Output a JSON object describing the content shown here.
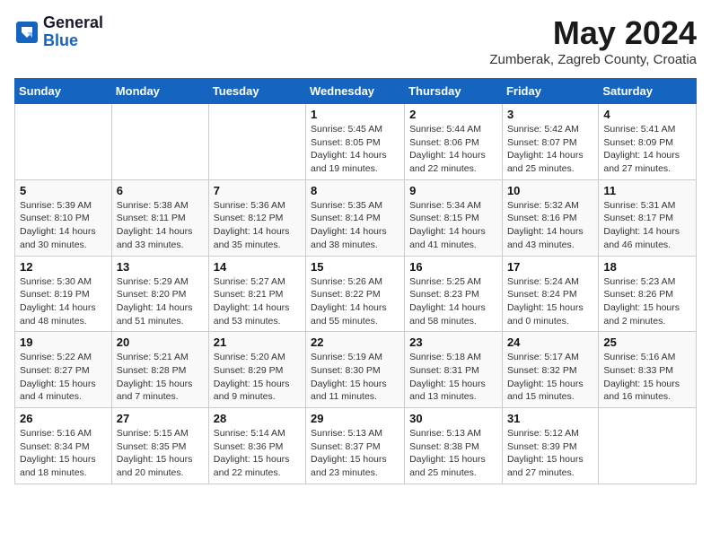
{
  "logo": {
    "general": "General",
    "blue": "Blue"
  },
  "header": {
    "month": "May 2024",
    "location": "Zumberak, Zagreb County, Croatia"
  },
  "weekdays": [
    "Sunday",
    "Monday",
    "Tuesday",
    "Wednesday",
    "Thursday",
    "Friday",
    "Saturday"
  ],
  "weeks": [
    [
      {
        "day": "",
        "info": ""
      },
      {
        "day": "",
        "info": ""
      },
      {
        "day": "",
        "info": ""
      },
      {
        "day": "1",
        "info": "Sunrise: 5:45 AM\nSunset: 8:05 PM\nDaylight: 14 hours\nand 19 minutes."
      },
      {
        "day": "2",
        "info": "Sunrise: 5:44 AM\nSunset: 8:06 PM\nDaylight: 14 hours\nand 22 minutes."
      },
      {
        "day": "3",
        "info": "Sunrise: 5:42 AM\nSunset: 8:07 PM\nDaylight: 14 hours\nand 25 minutes."
      },
      {
        "day": "4",
        "info": "Sunrise: 5:41 AM\nSunset: 8:09 PM\nDaylight: 14 hours\nand 27 minutes."
      }
    ],
    [
      {
        "day": "5",
        "info": "Sunrise: 5:39 AM\nSunset: 8:10 PM\nDaylight: 14 hours\nand 30 minutes."
      },
      {
        "day": "6",
        "info": "Sunrise: 5:38 AM\nSunset: 8:11 PM\nDaylight: 14 hours\nand 33 minutes."
      },
      {
        "day": "7",
        "info": "Sunrise: 5:36 AM\nSunset: 8:12 PM\nDaylight: 14 hours\nand 35 minutes."
      },
      {
        "day": "8",
        "info": "Sunrise: 5:35 AM\nSunset: 8:14 PM\nDaylight: 14 hours\nand 38 minutes."
      },
      {
        "day": "9",
        "info": "Sunrise: 5:34 AM\nSunset: 8:15 PM\nDaylight: 14 hours\nand 41 minutes."
      },
      {
        "day": "10",
        "info": "Sunrise: 5:32 AM\nSunset: 8:16 PM\nDaylight: 14 hours\nand 43 minutes."
      },
      {
        "day": "11",
        "info": "Sunrise: 5:31 AM\nSunset: 8:17 PM\nDaylight: 14 hours\nand 46 minutes."
      }
    ],
    [
      {
        "day": "12",
        "info": "Sunrise: 5:30 AM\nSunset: 8:19 PM\nDaylight: 14 hours\nand 48 minutes."
      },
      {
        "day": "13",
        "info": "Sunrise: 5:29 AM\nSunset: 8:20 PM\nDaylight: 14 hours\nand 51 minutes."
      },
      {
        "day": "14",
        "info": "Sunrise: 5:27 AM\nSunset: 8:21 PM\nDaylight: 14 hours\nand 53 minutes."
      },
      {
        "day": "15",
        "info": "Sunrise: 5:26 AM\nSunset: 8:22 PM\nDaylight: 14 hours\nand 55 minutes."
      },
      {
        "day": "16",
        "info": "Sunrise: 5:25 AM\nSunset: 8:23 PM\nDaylight: 14 hours\nand 58 minutes."
      },
      {
        "day": "17",
        "info": "Sunrise: 5:24 AM\nSunset: 8:24 PM\nDaylight: 15 hours\nand 0 minutes."
      },
      {
        "day": "18",
        "info": "Sunrise: 5:23 AM\nSunset: 8:26 PM\nDaylight: 15 hours\nand 2 minutes."
      }
    ],
    [
      {
        "day": "19",
        "info": "Sunrise: 5:22 AM\nSunset: 8:27 PM\nDaylight: 15 hours\nand 4 minutes."
      },
      {
        "day": "20",
        "info": "Sunrise: 5:21 AM\nSunset: 8:28 PM\nDaylight: 15 hours\nand 7 minutes."
      },
      {
        "day": "21",
        "info": "Sunrise: 5:20 AM\nSunset: 8:29 PM\nDaylight: 15 hours\nand 9 minutes."
      },
      {
        "day": "22",
        "info": "Sunrise: 5:19 AM\nSunset: 8:30 PM\nDaylight: 15 hours\nand 11 minutes."
      },
      {
        "day": "23",
        "info": "Sunrise: 5:18 AM\nSunset: 8:31 PM\nDaylight: 15 hours\nand 13 minutes."
      },
      {
        "day": "24",
        "info": "Sunrise: 5:17 AM\nSunset: 8:32 PM\nDaylight: 15 hours\nand 15 minutes."
      },
      {
        "day": "25",
        "info": "Sunrise: 5:16 AM\nSunset: 8:33 PM\nDaylight: 15 hours\nand 16 minutes."
      }
    ],
    [
      {
        "day": "26",
        "info": "Sunrise: 5:16 AM\nSunset: 8:34 PM\nDaylight: 15 hours\nand 18 minutes."
      },
      {
        "day": "27",
        "info": "Sunrise: 5:15 AM\nSunset: 8:35 PM\nDaylight: 15 hours\nand 20 minutes."
      },
      {
        "day": "28",
        "info": "Sunrise: 5:14 AM\nSunset: 8:36 PM\nDaylight: 15 hours\nand 22 minutes."
      },
      {
        "day": "29",
        "info": "Sunrise: 5:13 AM\nSunset: 8:37 PM\nDaylight: 15 hours\nand 23 minutes."
      },
      {
        "day": "30",
        "info": "Sunrise: 5:13 AM\nSunset: 8:38 PM\nDaylight: 15 hours\nand 25 minutes."
      },
      {
        "day": "31",
        "info": "Sunrise: 5:12 AM\nSunset: 8:39 PM\nDaylight: 15 hours\nand 27 minutes."
      },
      {
        "day": "",
        "info": ""
      }
    ]
  ]
}
